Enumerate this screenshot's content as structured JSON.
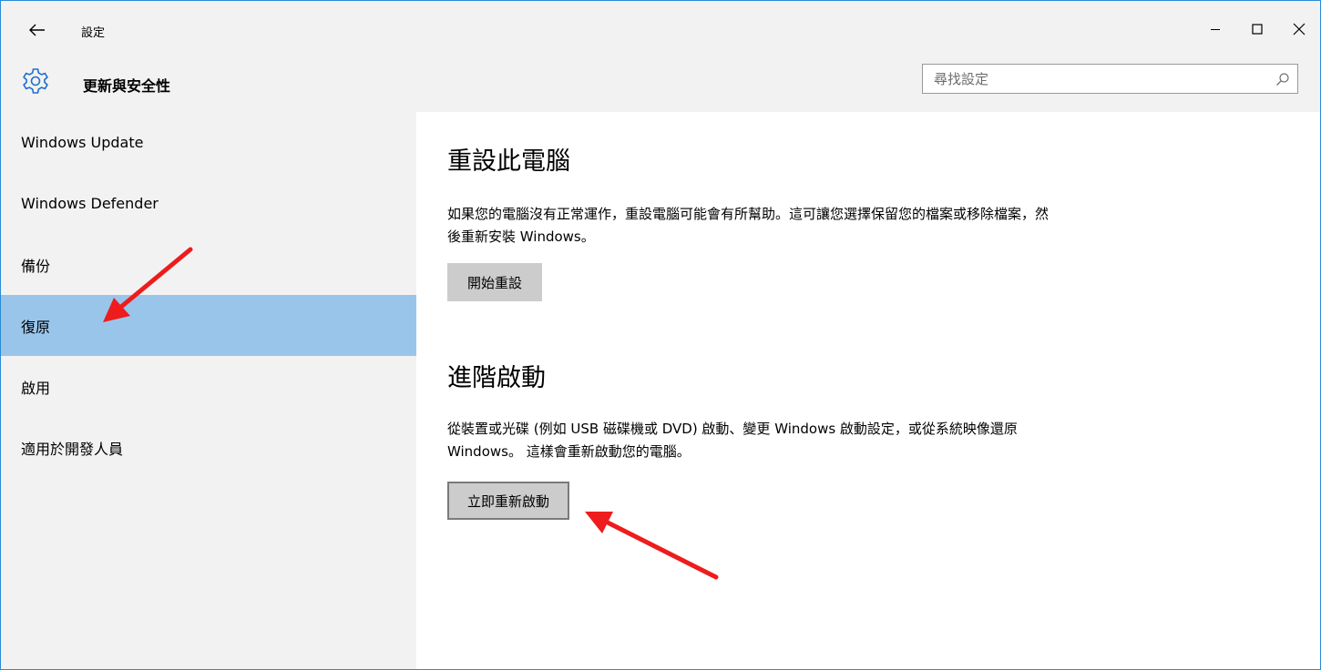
{
  "window": {
    "title": "設定"
  },
  "header": {
    "section_title": "更新與安全性",
    "search_placeholder": "尋找設定"
  },
  "sidebar": {
    "items": [
      {
        "label": "Windows Update"
      },
      {
        "label": "Windows Defender"
      },
      {
        "label": "備份"
      },
      {
        "label": "復原",
        "selected": true
      },
      {
        "label": "啟用"
      },
      {
        "label": "適用於開發人員"
      }
    ]
  },
  "main": {
    "reset": {
      "heading": "重設此電腦",
      "description": "如果您的電腦沒有正常運作，重設電腦可能會有所幫助。這可讓您選擇保留您的檔案或移除檔案，然後重新安裝 Windows。",
      "button_label": "開始重設"
    },
    "advanced": {
      "heading": "進階啟動",
      "description": "從裝置或光碟 (例如 USB 磁碟機或 DVD) 啟動、變更 Windows 啟動設定，或從系統映像還原 Windows。 這樣會重新啟動您的電腦。",
      "button_label": "立即重新啟動"
    }
  },
  "colors": {
    "selected_nav": "#99c5eb",
    "sidebar_bg": "#f2f2f2",
    "button_bg": "#cccccc",
    "annotation_arrow": "#ee1c1c",
    "window_border": "#2b8ad6"
  },
  "icons": {
    "back": "back-arrow-icon",
    "settings": "gear-icon",
    "search": "search-icon",
    "minimize": "minimize-icon",
    "maximize": "maximize-icon",
    "close": "close-icon"
  }
}
